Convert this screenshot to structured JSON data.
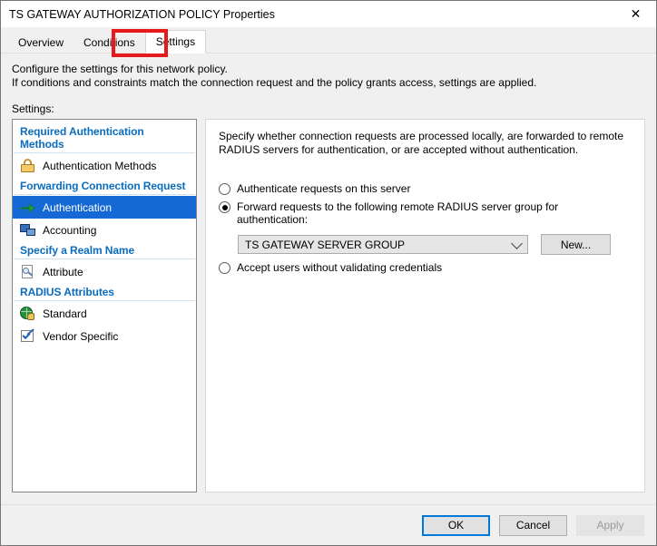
{
  "window": {
    "title": "TS GATEWAY AUTHORIZATION POLICY Properties",
    "close_icon": "close-icon"
  },
  "tabs": [
    {
      "label": "Overview",
      "active": false
    },
    {
      "label": "Conditions",
      "active": false
    },
    {
      "label": "Settings",
      "active": true
    }
  ],
  "annotation": {
    "color": "#e8191b",
    "target": "Settings"
  },
  "description": {
    "line1": "Configure the settings for this network policy.",
    "line2": "If conditions and constraints match the connection request and the policy grants access, settings are applied."
  },
  "settings_label": "Settings:",
  "tree": {
    "groups": [
      {
        "header": "Required Authentication Methods",
        "items": [
          {
            "label": "Authentication Methods",
            "icon": "lock-icon",
            "selected": false
          }
        ]
      },
      {
        "header": "Forwarding Connection Request",
        "items": [
          {
            "label": "Authentication",
            "icon": "green-arrow-icon",
            "selected": true
          },
          {
            "label": "Accounting",
            "icon": "computers-icon",
            "selected": false
          }
        ]
      },
      {
        "header": "Specify a Realm Name",
        "items": [
          {
            "label": "Attribute",
            "icon": "page-magnifier-icon",
            "selected": false
          }
        ]
      },
      {
        "header": "RADIUS Attributes",
        "items": [
          {
            "label": "Standard",
            "icon": "globe-key-icon",
            "selected": false
          },
          {
            "label": "Vendor Specific",
            "icon": "checkbox-pen-icon",
            "selected": false
          }
        ]
      }
    ],
    "header_color": "#0a6cbe",
    "selection_color": "#1669d4"
  },
  "panel": {
    "description": "Specify whether connection requests are processed locally, are forwarded to remote RADIUS servers for authentication, or are accepted without authentication.",
    "options": [
      {
        "label": "Authenticate requests on this server",
        "checked": false
      },
      {
        "label": "Forward requests to the following remote RADIUS server group for authentication:",
        "checked": true
      },
      {
        "label": "Accept users without validating credentials",
        "checked": false
      }
    ],
    "server_group": {
      "value": "TS GATEWAY SERVER GROUP",
      "new_button": "New..."
    }
  },
  "footer": {
    "ok": "OK",
    "cancel": "Cancel",
    "apply": "Apply",
    "apply_enabled": false
  }
}
